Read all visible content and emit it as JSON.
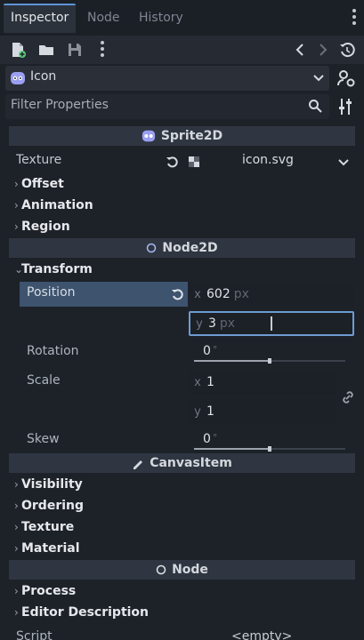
{
  "tabs": [
    {
      "label": "Inspector",
      "active": true
    },
    {
      "label": "Node",
      "active": false
    },
    {
      "label": "History",
      "active": false
    }
  ],
  "node_selector": {
    "name": "Icon",
    "icon": "godot-head-icon"
  },
  "filter": {
    "placeholder": "Filter Properties"
  },
  "sprite_section": {
    "title": "Sprite2D"
  },
  "texture": {
    "label": "Texture",
    "value": "icon.svg"
  },
  "sprite_groups": [
    "Offset",
    "Animation",
    "Region"
  ],
  "node2d_section": {
    "title": "Node2D"
  },
  "transform": {
    "label": "Transform",
    "position": {
      "label": "Position",
      "x": "602",
      "y": "3",
      "unit": "px"
    },
    "rotation": {
      "label": "Rotation",
      "value": "0",
      "unit": "°",
      "slider_fraction": 0.5
    },
    "scale": {
      "label": "Scale",
      "x": "1",
      "y": "1"
    },
    "skew": {
      "label": "Skew",
      "value": "0",
      "unit": "°",
      "slider_fraction": 0.5
    }
  },
  "canvas_section": {
    "title": "CanvasItem"
  },
  "canvas_groups": [
    "Visibility",
    "Ordering",
    "Texture",
    "Material"
  ],
  "node_section": {
    "title": "Node"
  },
  "node_groups": [
    "Process",
    "Editor Description"
  ],
  "script": {
    "label": "Script",
    "value": "<empty>"
  },
  "colors": {
    "accent": "#5e93d6",
    "position_highlight": "#3d536e",
    "background": "#1d2229"
  }
}
